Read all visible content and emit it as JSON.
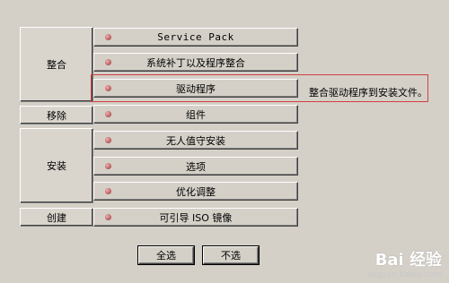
{
  "groups": {
    "integrate": "整合",
    "remove": "移除",
    "install": "安装",
    "create": "创建"
  },
  "tasks": [
    {
      "label": "Service Pack"
    },
    {
      "label": "系统补丁以及程序整合"
    },
    {
      "label": "驱动程序"
    },
    {
      "label": "组件"
    },
    {
      "label": "无人值守安装"
    },
    {
      "label": "选项"
    },
    {
      "label": "优化调整"
    },
    {
      "label": "可引导 ISO 镜像"
    }
  ],
  "hint": "整合驱动程序到安装文件。",
  "buttons": {
    "select_all": "全选",
    "select_none": "不选"
  },
  "watermark": {
    "logo": "Bai 经验",
    "url": "jingyan.baidu.com"
  },
  "colors": {
    "background": "#d4d0c8",
    "dot": "#c06868",
    "highlight": "#d04040"
  }
}
